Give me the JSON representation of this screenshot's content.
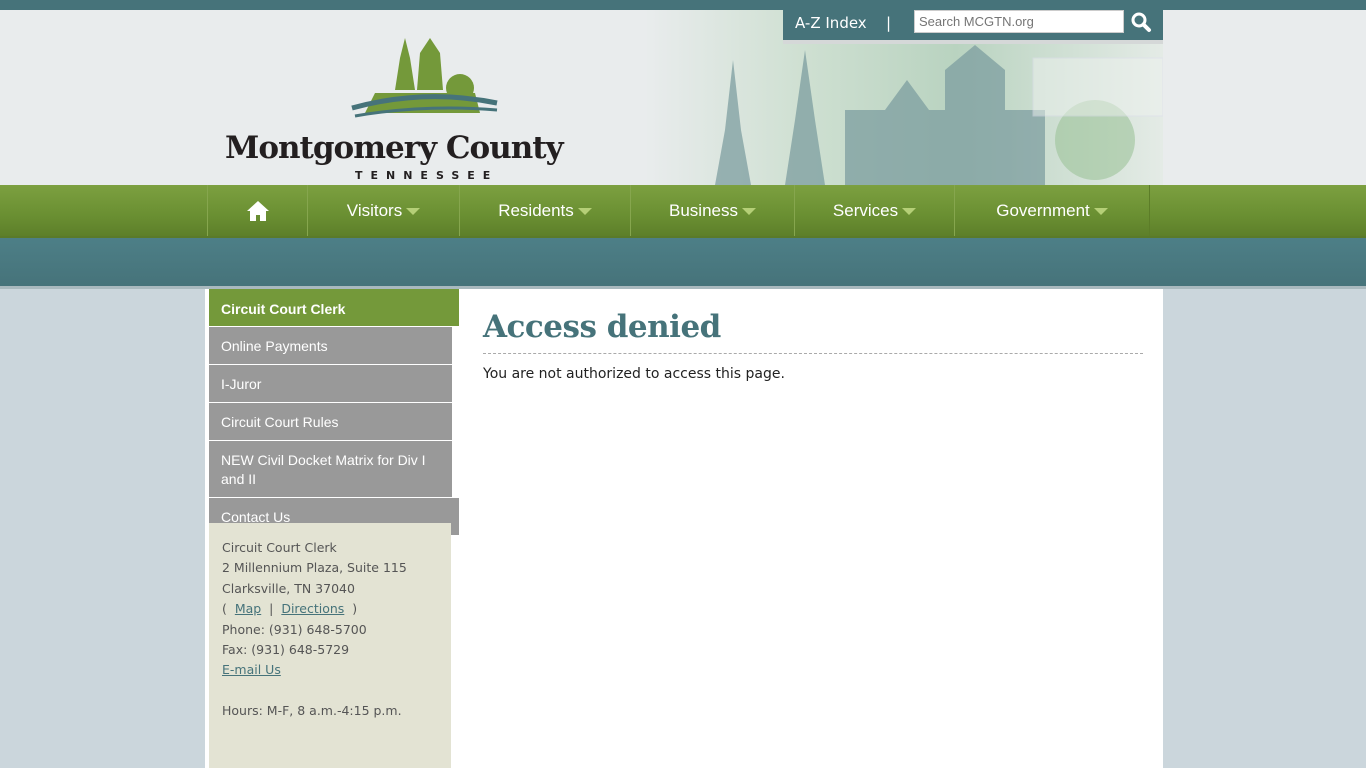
{
  "header": {
    "logo_title": "Montgomery County",
    "logo_subtitle": "TENNESSEE",
    "az_index": "A-Z Index",
    "separator": "|",
    "search_placeholder": "Search MCGTN.org"
  },
  "nav": {
    "items": [
      {
        "label": "Visitors"
      },
      {
        "label": "Residents"
      },
      {
        "label": "Business"
      },
      {
        "label": "Services"
      },
      {
        "label": "Government"
      }
    ]
  },
  "sidebar": {
    "title": "Circuit Court Clerk",
    "items": [
      {
        "label": "Online Payments"
      },
      {
        "label": "I-Juror"
      },
      {
        "label": "Circuit Court Rules"
      },
      {
        "label": "NEW Civil Docket Matrix for Div I and II"
      },
      {
        "label": "Contact Us"
      }
    ]
  },
  "contact": {
    "name": "Circuit Court Clerk",
    "street": "2 Millennium Plaza, Suite 115",
    "city": "Clarksville, TN 37040",
    "map": "Map",
    "directions": "Directions",
    "phone": "Phone: (931) 648-5700",
    "fax": "Fax: (931) 648-5729",
    "email": "E-mail Us",
    "hours": "Hours: M-F, 8 a.m.-4:15 p.m."
  },
  "main": {
    "title": "Access denied",
    "message": "You are not authorized to access this page."
  },
  "colors": {
    "teal": "#46737a",
    "green": "#74993a",
    "sidebar_gray": "#999999"
  }
}
